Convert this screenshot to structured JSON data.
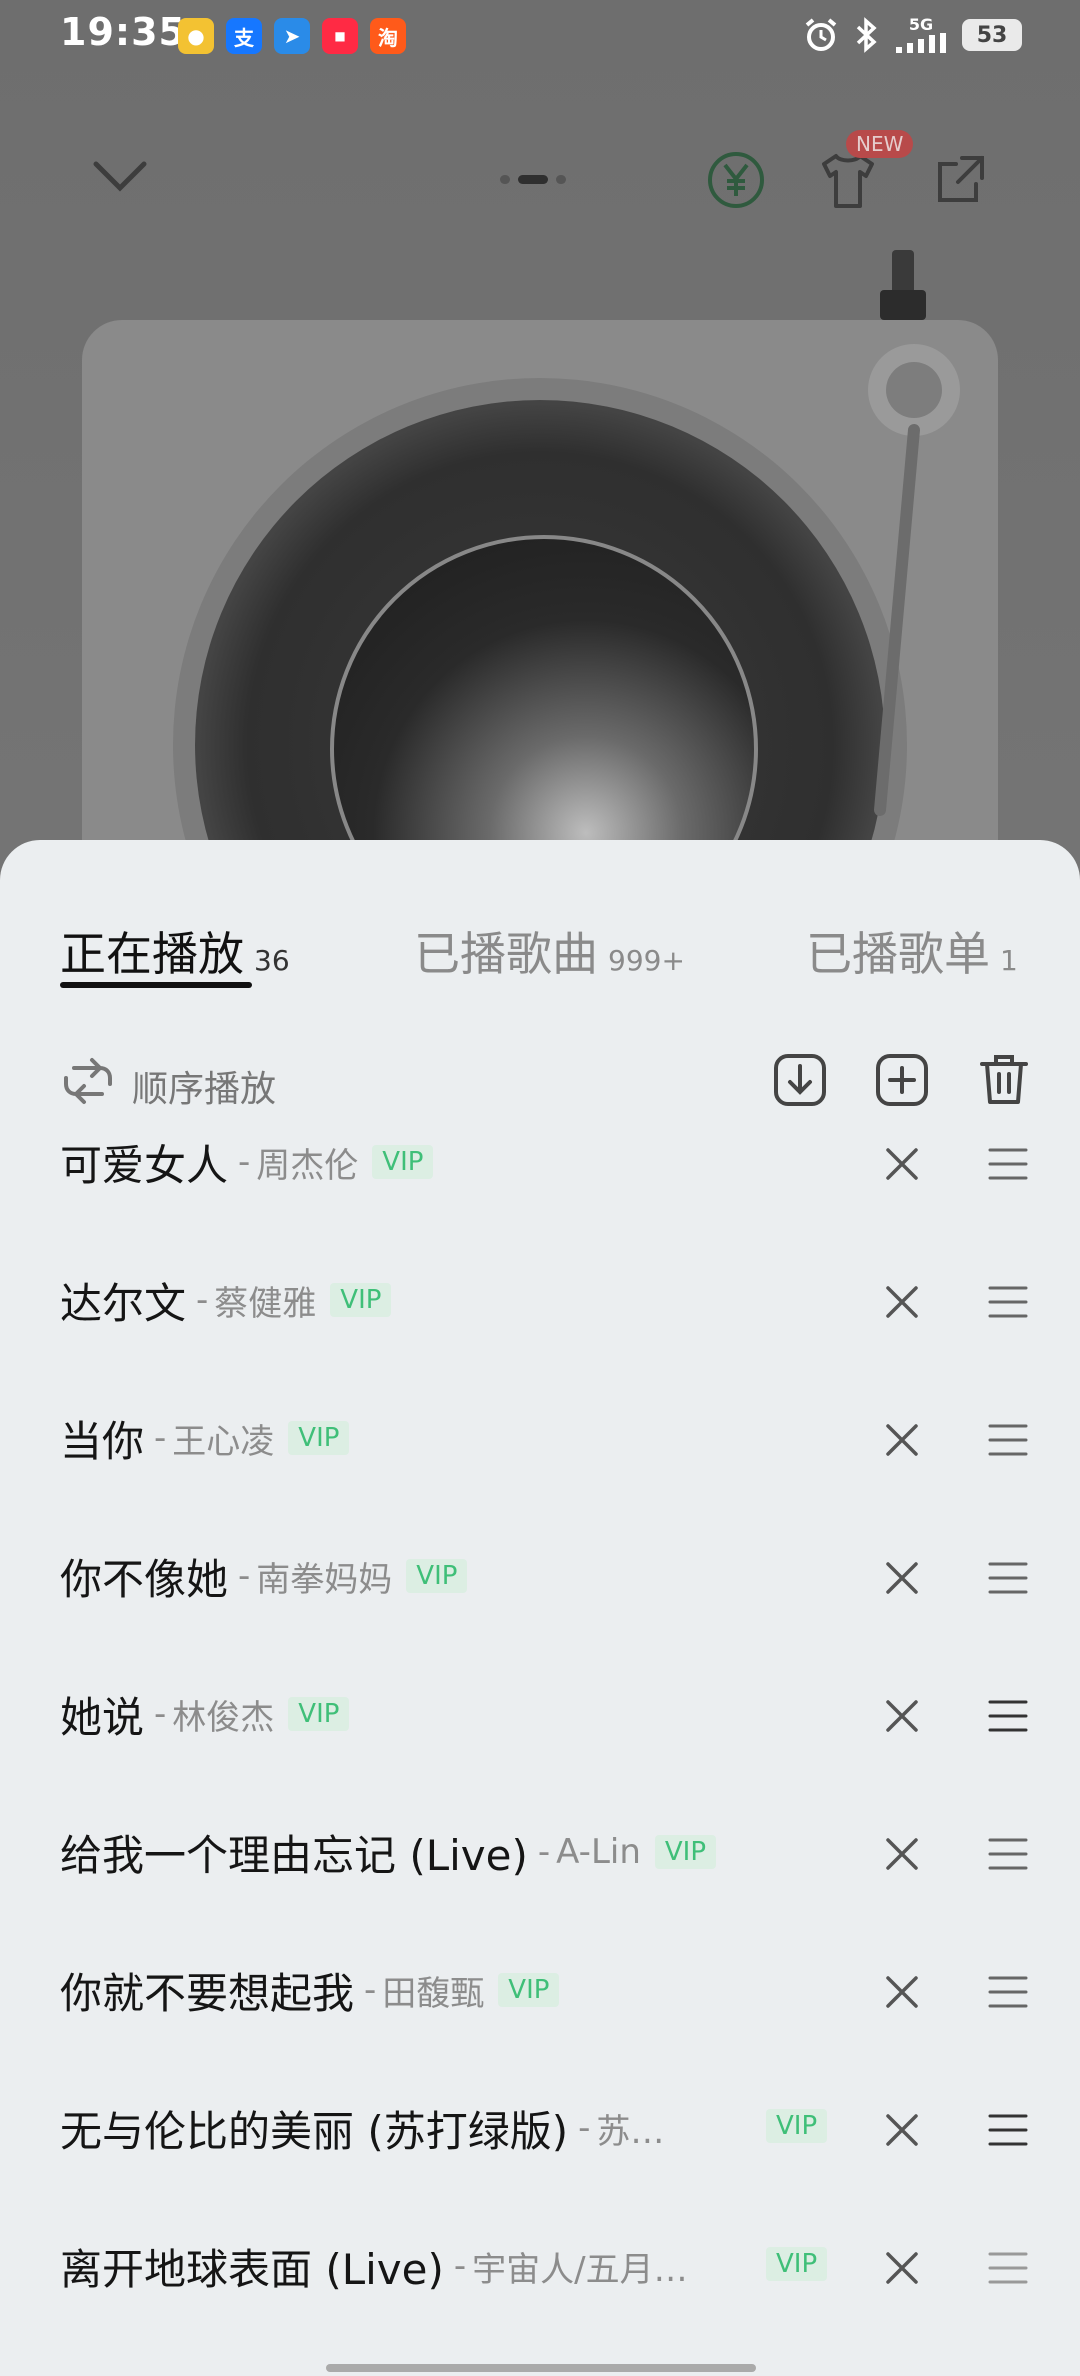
{
  "status_bar": {
    "time": "19:35",
    "network": "5G",
    "battery": "53"
  },
  "top_bar": {
    "new_badge": "NEW"
  },
  "tabs": [
    {
      "label": "正在播放",
      "count": "36"
    },
    {
      "label": "已播歌曲",
      "count": "999+"
    },
    {
      "label": "已播歌单",
      "count": "1"
    }
  ],
  "play_mode": {
    "label": "顺序播放"
  },
  "songs": [
    {
      "title": "可爱女人",
      "artist": "周杰伦",
      "badge": "VIP"
    },
    {
      "title": "达尔文",
      "artist": "蔡健雅",
      "badge": "VIP"
    },
    {
      "title": "当你",
      "artist": "王心凌",
      "badge": "VIP"
    },
    {
      "title": "你不像她",
      "artist": "南拳妈妈",
      "badge": "VIP"
    },
    {
      "title": "她说",
      "artist": "林俊杰",
      "badge": "VIP"
    },
    {
      "title": "给我一个理由忘记 (Live)",
      "artist": "A-Lin",
      "badge": "VIP"
    },
    {
      "title": "你就不要想起我",
      "artist": "田馥甄",
      "badge": "VIP"
    },
    {
      "title": "无与伦比的美丽 (苏打绿版)",
      "artist": "苏…",
      "badge": "VIP"
    },
    {
      "title": "离开地球表面 (Live)",
      "artist": "宇宙人/五月…",
      "badge": "VIP"
    }
  ],
  "colors": {
    "accent_green": "#3fbf78",
    "sheet_background": "#ebeef0",
    "new_badge": "#b84a4a"
  }
}
